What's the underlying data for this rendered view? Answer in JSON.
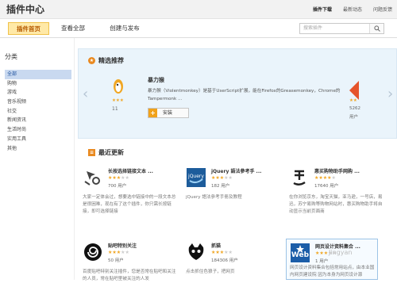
{
  "header": {
    "title": "插件中心",
    "links": [
      "插件下载",
      "最新动态",
      "问题反馈"
    ]
  },
  "tabs": [
    "插件首页",
    "查看全部",
    "创建与发布"
  ],
  "search": {
    "placeholder": "搜索插件"
  },
  "sidebar": {
    "title": "分类",
    "items": [
      "全部",
      "购物",
      "游戏",
      "音乐视频",
      "社交",
      "新闻资讯",
      "生活时尚",
      "实用工具",
      "其他"
    ]
  },
  "featured": {
    "heading": "精选推荐",
    "prev_partial": "11",
    "name": "暴力猴",
    "description": "暴力猴（Violentmonkey）是基于UserScript扩展，能在Firefox的Greasemonkey，Chrome的Tampermonk ...",
    "install_label": "安装",
    "next_partial_count": "5262",
    "next_partial_users": "用户"
  },
  "updates": {
    "heading": "最近更新",
    "cards": [
      {
        "name": "长按选择链接文本 ...",
        "users": "700 用户",
        "desc": "大家一定体会过，想要选中链接中的一段文本总是很困难，现在有了这个插件，你只需长按链接，即可选择链接"
      },
      {
        "name": "jQuery 語法參考手 ...",
        "users": "182 用户",
        "desc": "jQuery 語法參考手冊及教程"
      },
      {
        "name": "惠买购物助手网购 ...",
        "users": "17640 用户",
        "desc": "在你浏览京东，淘宝天猫，亚马逊，一号店，易迅，苏宁易购等购物网站时，惠买购物助手将自动显示当前页面商"
      },
      {
        "name": "贴吧特别关注",
        "users": "50 用户",
        "desc": "百度贴吧特别关注插件，您是否常在贴吧和关注的人员，常在贴吧里被关注的人发"
      },
      {
        "name": "抓猫",
        "users": "184306 用户",
        "desc": "点击抓住色狼子，把网页"
      },
      {
        "name": "网页设计资料集合 ...",
        "users": "1 用户",
        "desc": "网页设计资料集合包括常用站点，由本业国内网页建设院 因为本身为网页设计源"
      }
    ]
  },
  "watermark": "Jingyan"
}
